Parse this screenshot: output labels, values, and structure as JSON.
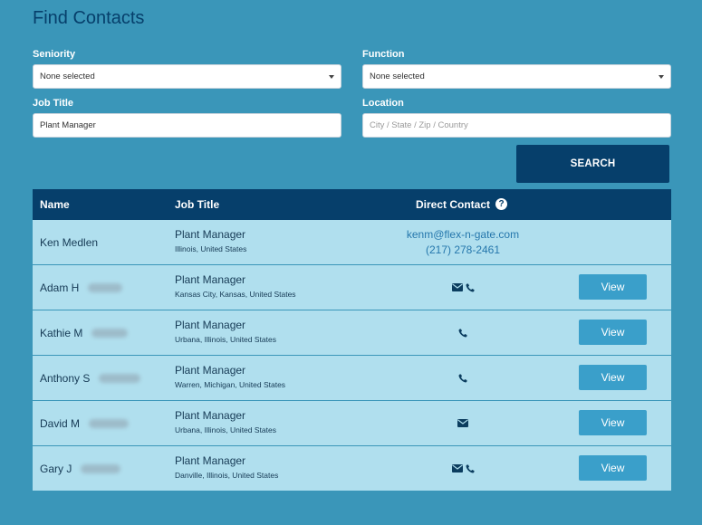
{
  "page": {
    "title": "Find Contacts"
  },
  "filters": {
    "seniority": {
      "label": "Seniority",
      "value": "None selected"
    },
    "function": {
      "label": "Function",
      "value": "None selected"
    },
    "job_title": {
      "label": "Job Title",
      "value": "Plant Manager"
    },
    "location": {
      "label": "Location",
      "value": "",
      "placeholder": "City / State / Zip / Country"
    },
    "search_label": "SEARCH"
  },
  "table": {
    "headers": {
      "name": "Name",
      "job_title": "Job Title",
      "direct_contact": "Direct Contact",
      "help_icon": "?"
    },
    "view_label": "View",
    "rows": [
      {
        "name": "Ken Medlen",
        "title": "Plant Manager",
        "location": "Illinois, United States",
        "email": "kenm@flex-n-gate.com",
        "phone": "(217) 278-2461",
        "icons": []
      },
      {
        "name": "Adam H",
        "title": "Plant Manager",
        "location": "Kansas City, Kansas, United States",
        "icons": [
          "envelope-icon",
          "phone-icon"
        ]
      },
      {
        "name": "Kathie M",
        "title": "Plant Manager",
        "location": "Urbana, Illinois, United States",
        "icons": [
          "phone-icon"
        ]
      },
      {
        "name": "Anthony S",
        "title": "Plant Manager",
        "location": "Warren, Michigan, United States",
        "icons": [
          "phone-icon"
        ]
      },
      {
        "name": "David M",
        "title": "Plant Manager",
        "location": "Urbana, Illinois, United States",
        "icons": [
          "envelope-icon"
        ]
      },
      {
        "name": "Gary J",
        "title": "Plant Manager",
        "location": "Danville, Illinois, United States",
        "icons": [
          "envelope-icon",
          "phone-icon"
        ]
      }
    ]
  },
  "colors": {
    "background": "#3a96b9",
    "header": "#063f6b",
    "row": "#b0dfee",
    "button": "#3a9fca",
    "link": "#2577ac"
  }
}
